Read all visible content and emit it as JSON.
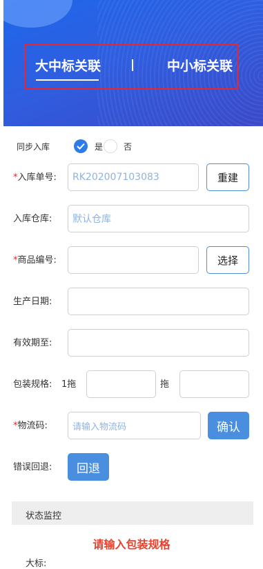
{
  "header": {
    "tabs": [
      {
        "label": "大中标关联",
        "active": true
      },
      {
        "label": "中小标关联",
        "active": false
      }
    ],
    "separator": "|",
    "colors": {
      "banner": "#2f5ee0",
      "highlight_border": "#e8262d"
    }
  },
  "sync": {
    "label": "同步入库",
    "options": [
      {
        "label": "是",
        "selected": true
      },
      {
        "label": "否",
        "selected": false
      }
    ]
  },
  "inbound_no": {
    "label": "入库单号:",
    "value": "RK202007103083",
    "button": "重建"
  },
  "warehouse": {
    "label": "入库仓库:",
    "value": "默认仓库"
  },
  "product_code": {
    "label": "商品编号:",
    "value": "",
    "button": "选择"
  },
  "production_date": {
    "label": "生产日期:",
    "value": ""
  },
  "expiry": {
    "label": "有效期至:",
    "value": ""
  },
  "pack_spec": {
    "label": "包装规格:",
    "prefix": "1拖",
    "suffix": "拖",
    "value1": "",
    "value2": ""
  },
  "logistics": {
    "label": "物流码:",
    "placeholder": "请输入物流码",
    "button": "确认"
  },
  "rollback": {
    "label": "错误回退:",
    "button": "回退"
  },
  "status": {
    "title": "状态监控",
    "message": "请输入包装规格",
    "partial_label": "大标:"
  },
  "colors": {
    "accent": "#4a8fdf",
    "required": "#e8262d",
    "error": "#e8422e"
  }
}
